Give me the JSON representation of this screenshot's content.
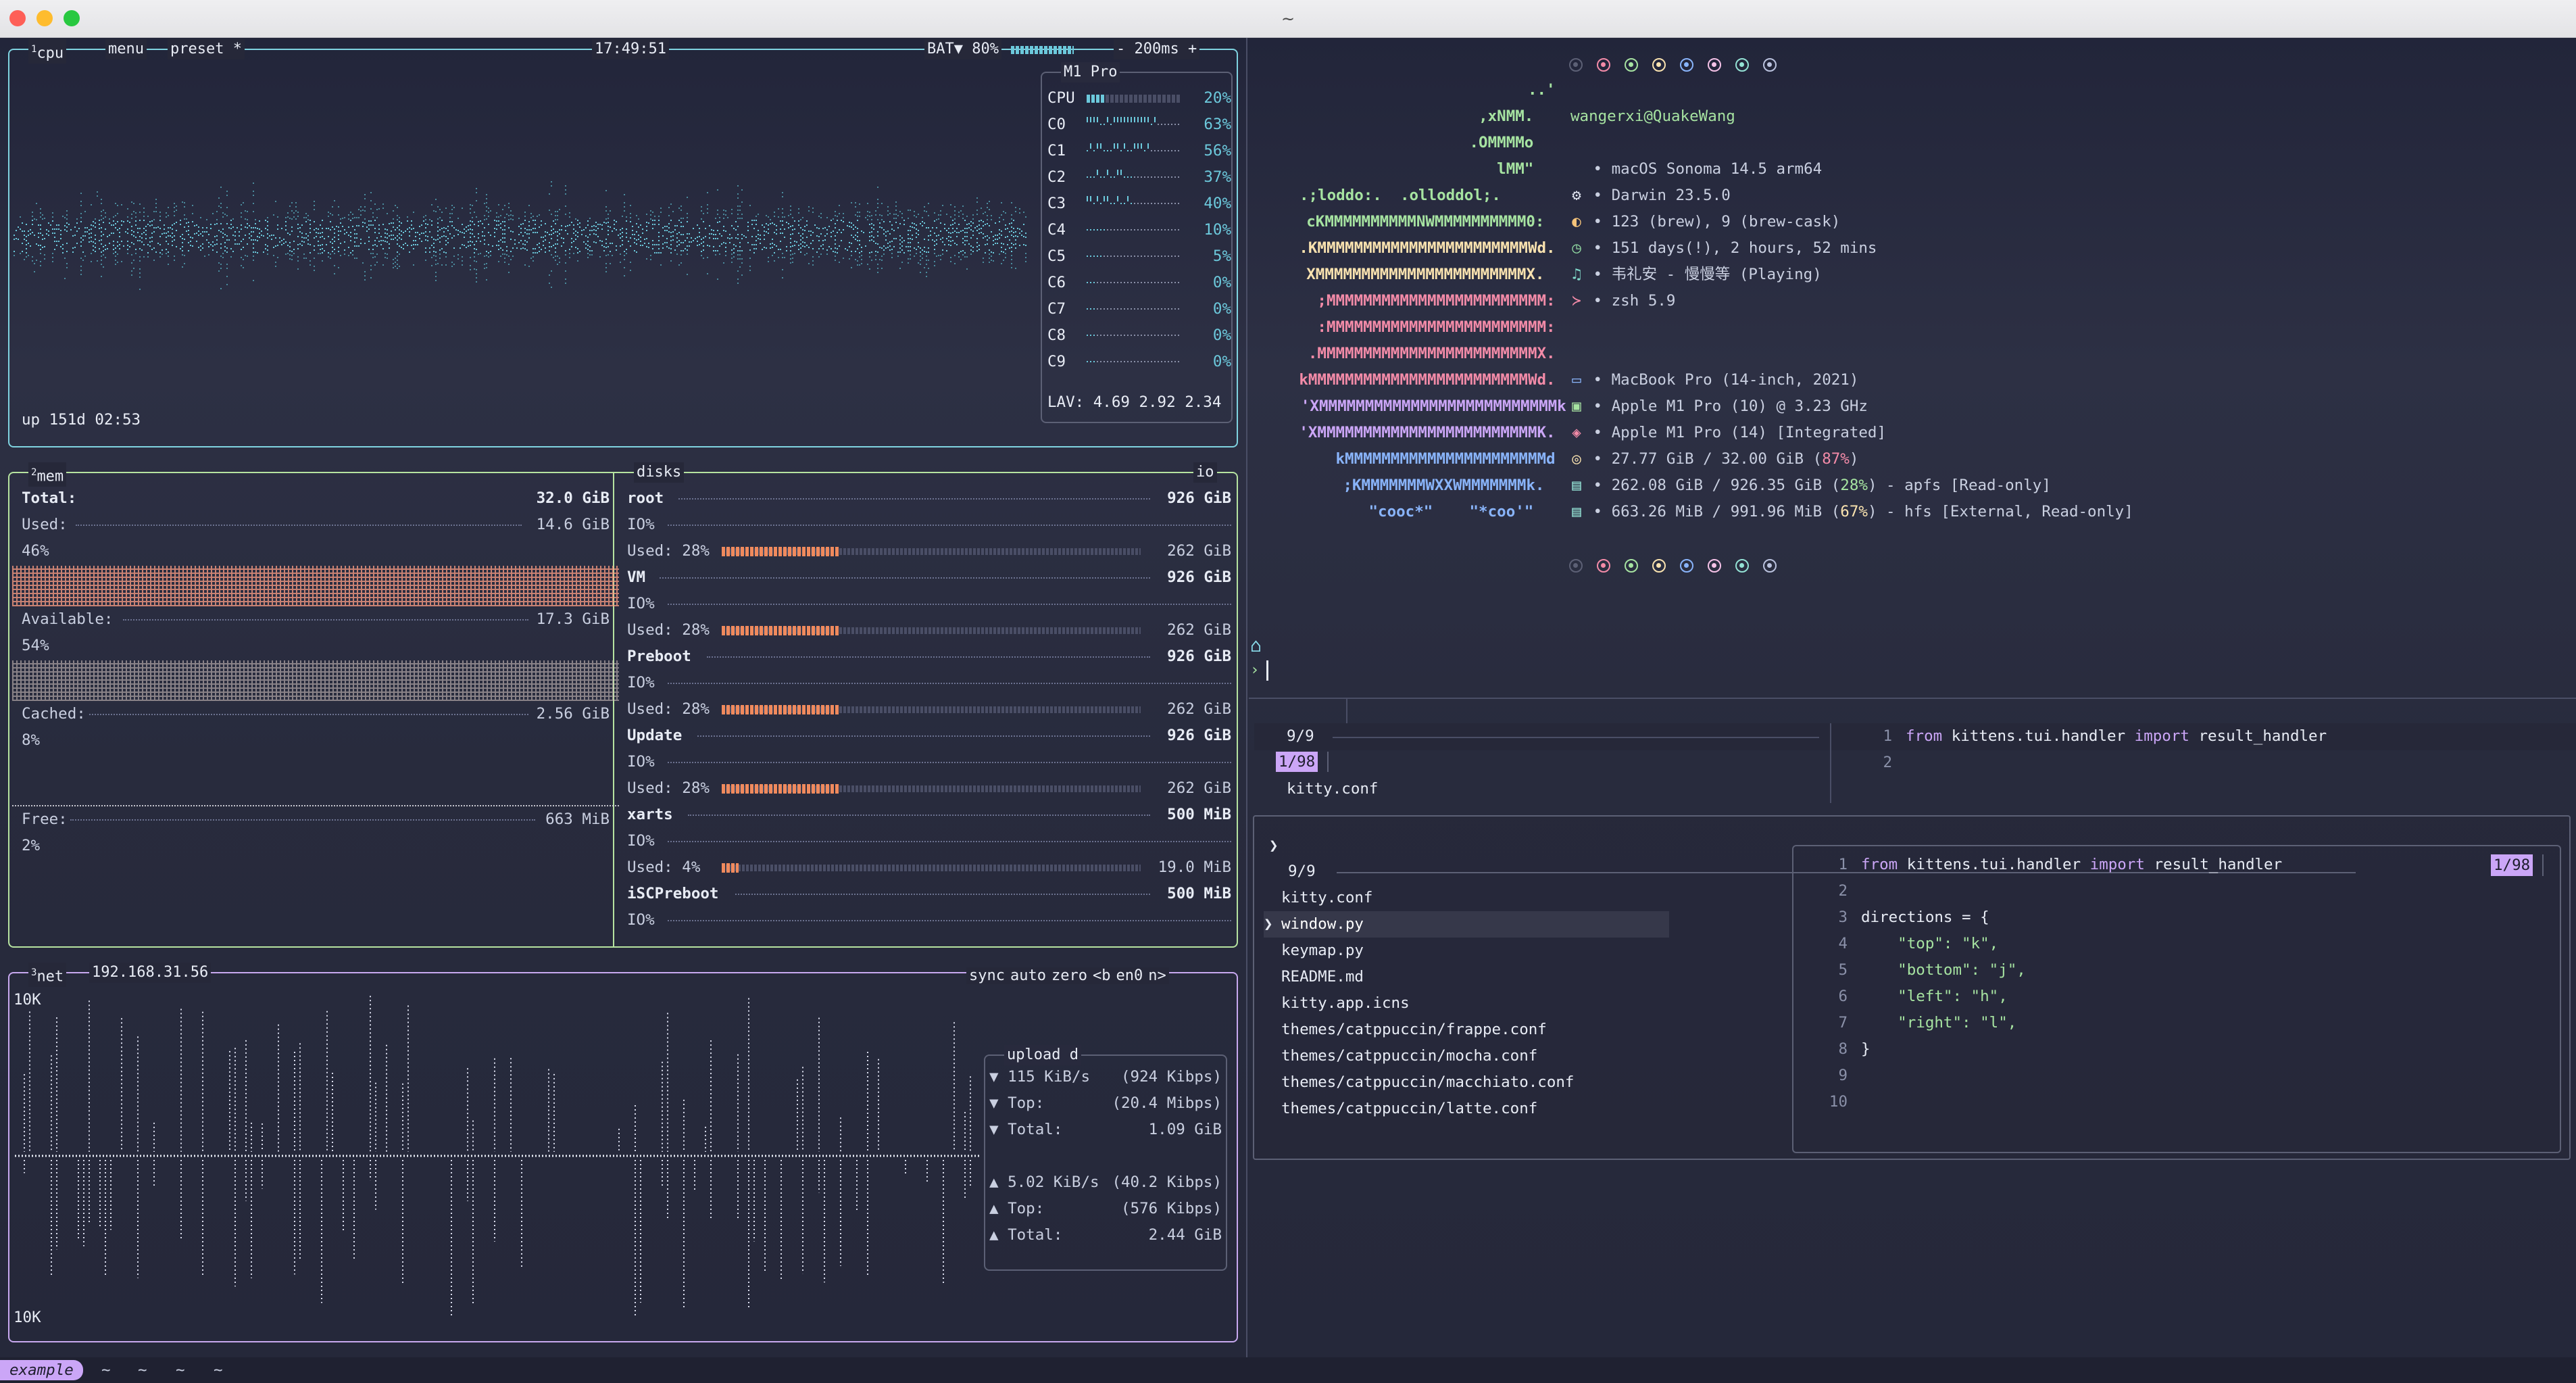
{
  "window": {
    "title": "~"
  },
  "btop": {
    "cpu": {
      "header": {
        "index": "1",
        "name": "cpu",
        "menu": "menu",
        "preset": "preset *",
        "time": "17:49:51",
        "battery": "BAT▼ 80%",
        "battery_level": 0.8,
        "interval": "- 200ms +"
      },
      "model": "M1 Pro",
      "cores": [
        {
          "name": "CPU",
          "pct": "20%",
          "value": 0.2
        },
        {
          "name": "C0",
          "pct": "63%",
          "value": 0.63
        },
        {
          "name": "C1",
          "pct": "56%",
          "value": 0.56
        },
        {
          "name": "C2",
          "pct": "37%",
          "value": 0.37
        },
        {
          "name": "C3",
          "pct": "40%",
          "value": 0.4
        },
        {
          "name": "C4",
          "pct": "10%",
          "value": 0.1
        },
        {
          "name": "C5",
          "pct": "5%",
          "value": 0.05
        },
        {
          "name": "C6",
          "pct": "0%",
          "value": 0
        },
        {
          "name": "C7",
          "pct": "0%",
          "value": 0
        },
        {
          "name": "C8",
          "pct": "0%",
          "value": 0
        },
        {
          "name": "C9",
          "pct": "0%",
          "value": 0
        }
      ],
      "lav": "LAV: 4.69 2.92 2.34",
      "uptime": "up 151d 02:53"
    },
    "mem": {
      "index": "2",
      "name": "mem",
      "total_label": "Total:",
      "total": "32.0 GiB",
      "used_label": "Used:",
      "used": "14.6 GiB",
      "used_pct": "46%",
      "avail_label": "Available:",
      "avail": "17.3 GiB",
      "avail_pct": "54%",
      "cached_label": "Cached:",
      "cached": "2.56 GiB",
      "cached_pct": "8%",
      "free_label": "Free:",
      "free": "663 MiB",
      "free_pct": "2%"
    },
    "disks": {
      "name": "disks",
      "io": "io",
      "items": [
        {
          "name": "root",
          "size": "926 GiB",
          "io": "IO%",
          "used_label": "Used: 28%",
          "used": "262 GiB",
          "value": 0.28
        },
        {
          "name": "VM",
          "size": "926 GiB",
          "io": "IO%",
          "used_label": "Used: 28%",
          "used": "262 GiB",
          "value": 0.28
        },
        {
          "name": "Preboot",
          "size": "926 GiB",
          "io": "IO%",
          "used_label": "Used: 28%",
          "used": "262 GiB",
          "value": 0.28
        },
        {
          "name": "Update",
          "size": "926 GiB",
          "io": "IO%",
          "used_label": "Used: 28%",
          "used": "262 GiB",
          "value": 0.28
        },
        {
          "name": "xarts",
          "size": "500 MiB",
          "io": "IO%",
          "used_label": "Used:  4%",
          "used": "19.0 MiB",
          "value": 0.04
        },
        {
          "name": "iSCPreboot",
          "size": "500 MiB",
          "io": "IO%"
        }
      ]
    },
    "net": {
      "index": "3",
      "name": "net",
      "ip": "192.168.31.56",
      "controls": [
        "sync",
        "auto",
        "zero",
        "<b",
        "en0",
        "n>"
      ],
      "scale_top": "10K",
      "scale_bottom": "10K",
      "box_title": "upload",
      "box_title_suffix": "d",
      "down": {
        "rate": "▼ 115 KiB/s",
        "rate_bits": "(924 Kibps)",
        "top_label": "▼ Top:",
        "top": "(20.4 Mibps)",
        "total_label": "▼ Total:",
        "total": "1.09 GiB"
      },
      "up": {
        "rate": "▲ 5.02 KiB/s",
        "rate_bits": "(40.2 Kibps)",
        "top_label": "▲ Top:",
        "top": "(576 Kibps)",
        "total_label": "▲ Total:",
        "total": "2.44 GiB"
      }
    }
  },
  "fastfetch": {
    "logo": [
      "..'",
      ",xNMM.",
      ".OMMMMo",
      "lMM\"",
      ".;loddo:.  .olloddol;.",
      "cKMMMMMMMMMMNWMMMMMMMMMM0:",
      ".KMMMMMMMMMMMMMMMMMMMMMMMWd.",
      "XMMMMMMMMMMMMMMMMMMMMMMMX.",
      ";MMMMMMMMMMMMMMMMMMMMMMMM:",
      ":MMMMMMMMMMMMMMMMMMMMMMMM:",
      ".MMMMMMMMMMMMMMMMMMMMMMMMX.",
      "kMMMMMMMMMMMMMMMMMMMMMMMMWd.",
      "'XMMMMMMMMMMMMMMMMMMMMMMMMMMk",
      "'XMMMMMMMMMMMMMMMMMMMMMMMMK.",
      "kMMMMMMMMMMMMMMMMMMMMMMd",
      ";KMMMMMMMWXXWMMMMMMMk.",
      "\"cooc*\"    \"*coo'\""
    ],
    "user": "wangerxi@QuakeWang",
    "lines": [
      {
        "icon": "apple-icon",
        "glyph": "",
        "text": "• macOS Sonoma 14.5 arm64",
        "color": "#9aa7ff"
      },
      {
        "icon": "gear-icon",
        "glyph": "⚙",
        "text": "• Darwin 23.5.0",
        "color": "#e0e4f0"
      },
      {
        "icon": "package-icon",
        "glyph": "◐",
        "text": "• 123 (brew), 9 (brew-cask)",
        "color": "#f5c37a"
      },
      {
        "icon": "clock-icon",
        "glyph": "◷",
        "text": "• 151 days(!), 2 hours, 52 mins",
        "color": "#8fd6a0"
      },
      {
        "icon": "music-icon",
        "glyph": "♫",
        "text": "• 韦礼安 - 慢慢等 (Playing)",
        "color": "#7fd8c9"
      },
      {
        "icon": "terminal-icon",
        "glyph": "≻",
        "text": "• zsh 5.9",
        "color": "#f38ba8"
      },
      {
        "icon": "laptop-icon",
        "glyph": "▭",
        "text": "• MacBook Pro (14-inch, 2021)",
        "color": "#89b4fa"
      },
      {
        "icon": "cpu-icon",
        "glyph": "▣",
        "text": "• Apple M1 Pro (10) @ 3.23 GHz",
        "color": "#a6e3a1"
      },
      {
        "icon": "gpu-icon",
        "glyph": "◈",
        "text": "• Apple M1 Pro (14) [Integrated]",
        "color": "#f38ba8"
      },
      {
        "icon": "memory-icon",
        "glyph": "◎",
        "text_pre": "• 27.77 GiB / 32.00 GiB (",
        "hl": "87%",
        "hl_color": "#f38ba8",
        "text_post": ")",
        "color": "#f9e2af"
      },
      {
        "icon": "disk-icon",
        "glyph": "▤",
        "text_pre": "• 262.08 GiB / 926.35 GiB (",
        "hl": "28%",
        "hl_color": "#a6e3a1",
        "text_post": ") - apfs [Read-only]",
        "color": "#94e2d5"
      },
      {
        "icon": "disk-external-icon",
        "glyph": "▤",
        "text_pre": "• 663.26 MiB / 991.96 MiB (",
        "hl": "67%",
        "hl_color": "#f9e2af",
        "text_post": ") - hfs [External, Read-only]",
        "color": "#94e2d5"
      }
    ],
    "palette": [
      "#5c6075",
      "#f38ba8",
      "#a6e3a1",
      "#f9e2af",
      "#89b4fa",
      "#f5c2e7",
      "#94e2d5",
      "#bac2de"
    ],
    "prompt": "›"
  },
  "fzf_bg": {
    "count": "9/9",
    "position": "1/98",
    "item": "kitty.conf",
    "preview": [
      {
        "n": "1",
        "code": [
          {
            "t": "from ",
            "c": "kw"
          },
          {
            "t": "kittens.tui.handler ",
            "c": "tx"
          },
          {
            "t": "import ",
            "c": "kw"
          },
          {
            "t": "result_handler",
            "c": "tx"
          }
        ]
      },
      {
        "n": "2",
        "code": []
      }
    ]
  },
  "fzf": {
    "prompt": "❯",
    "count": "9/9",
    "position": "1/98",
    "items": [
      "kitty.conf",
      "window.py",
      "keymap.py",
      "README.md",
      "kitty.app.icns",
      "themes/catppuccin/frappe.conf",
      "themes/catppuccin/mocha.conf",
      "themes/catppuccin/macchiato.conf",
      "themes/catppuccin/latte.conf"
    ],
    "selected_index": 1,
    "cursor": "❯",
    "preview": [
      {
        "n": "1",
        "code": [
          {
            "t": "from ",
            "c": "kw"
          },
          {
            "t": "kittens.tui.handler ",
            "c": "tx"
          },
          {
            "t": "import ",
            "c": "kw"
          },
          {
            "t": "result_handler",
            "c": "tx"
          }
        ]
      },
      {
        "n": "2",
        "code": []
      },
      {
        "n": "3",
        "code": [
          {
            "t": "directions = {",
            "c": "tx"
          }
        ]
      },
      {
        "n": "4",
        "code": [
          {
            "t": "    \"top\": \"k\",",
            "c": "st"
          }
        ]
      },
      {
        "n": "5",
        "code": [
          {
            "t": "    \"bottom\": \"j\",",
            "c": "st"
          }
        ]
      },
      {
        "n": "6",
        "code": [
          {
            "t": "    \"left\": \"h\",",
            "c": "st"
          }
        ]
      },
      {
        "n": "7",
        "code": [
          {
            "t": "    \"right\": \"l\",",
            "c": "st"
          }
        ]
      },
      {
        "n": "8",
        "code": [
          {
            "t": "}",
            "c": "tx"
          }
        ]
      },
      {
        "n": "9",
        "code": []
      },
      {
        "n": "10",
        "code": []
      }
    ]
  },
  "tabs": {
    "active": "example",
    "others": [
      "~",
      "~",
      "~",
      "~"
    ]
  },
  "colors": {
    "cpu": "#7fd3e0",
    "mem": "#b6e3a0",
    "net": "#c8a8f0",
    "accent": "#cba6f7",
    "keyword": "#cba6f7",
    "string": "#a6e3a1"
  }
}
